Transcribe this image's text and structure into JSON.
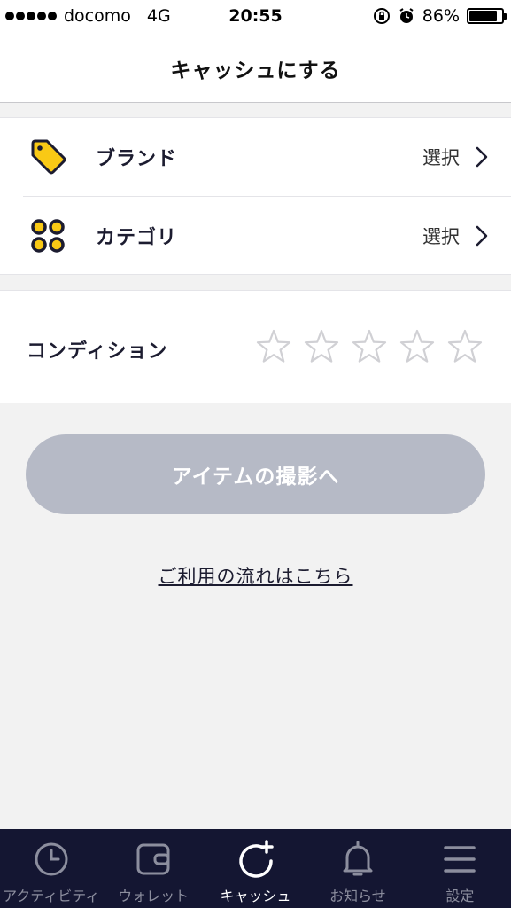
{
  "status_bar": {
    "carrier": "docomo",
    "network": "4G",
    "time": "20:55",
    "battery": "86%",
    "battery_level": 0.86
  },
  "header": {
    "title": "キャッシュにする"
  },
  "selection": {
    "brand": {
      "label": "ブランド",
      "value": "選択",
      "icon": "tag-icon"
    },
    "category": {
      "label": "カテゴリ",
      "value": "選択",
      "icon": "four-dots-icon"
    }
  },
  "condition": {
    "label": "コンディション",
    "rating": 0,
    "max_rating": 5
  },
  "cta": {
    "label": "アイテムの撮影へ"
  },
  "flow_link": {
    "label": "ご利用の流れはこちら"
  },
  "tab_bar": {
    "tabs": [
      {
        "label": "アクティビティ",
        "icon": "clock-icon"
      },
      {
        "label": "ウォレット",
        "icon": "wallet-icon"
      },
      {
        "label": "キャッシュ",
        "icon": "cash-add-icon"
      },
      {
        "label": "お知らせ",
        "icon": "bell-icon"
      },
      {
        "label": "設定",
        "icon": "menu-icon"
      }
    ],
    "active_index": 2
  },
  "colors": {
    "accent_yellow": "#f9c915",
    "tab_bar_bg": "#141632",
    "cta_disabled": "#b6bac6",
    "star_empty": "#d0d0d4"
  }
}
